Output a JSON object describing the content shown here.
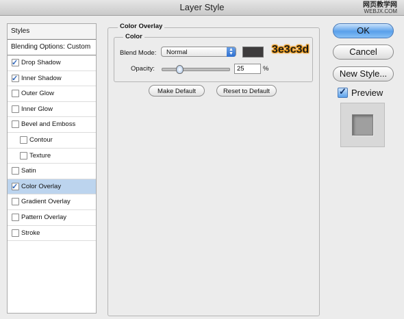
{
  "window": {
    "title": "Layer Style",
    "watermark_line1": "网页教学网",
    "watermark_line2": "WEBJX.COM"
  },
  "styles_panel": {
    "header": "Styles",
    "blending_options": "Blending Options: Custom",
    "items": [
      {
        "label": "Drop Shadow",
        "checked": true
      },
      {
        "label": "Inner Shadow",
        "checked": true
      },
      {
        "label": "Outer Glow",
        "checked": false
      },
      {
        "label": "Inner Glow",
        "checked": false
      },
      {
        "label": "Bevel and Emboss",
        "checked": false
      },
      {
        "label": "Contour",
        "checked": false
      },
      {
        "label": "Texture",
        "checked": false
      },
      {
        "label": "Satin",
        "checked": false
      },
      {
        "label": "Color Overlay",
        "checked": true
      },
      {
        "label": "Gradient Overlay",
        "checked": false
      },
      {
        "label": "Pattern Overlay",
        "checked": false
      },
      {
        "label": "Stroke",
        "checked": false
      }
    ]
  },
  "color_overlay": {
    "group_title": "Color Overlay",
    "subgroup_title": "Color",
    "blend_mode_label": "Blend Mode:",
    "blend_mode_value": "Normal",
    "swatch_color": "#3e3c3d",
    "hex_annotation": "3e3c3d",
    "opacity_label": "Opacity:",
    "opacity_value": "25",
    "opacity_unit": "%",
    "opacity_fraction": 0.25,
    "make_default_label": "Make Default",
    "reset_default_label": "Reset to Default"
  },
  "actions": {
    "ok_label": "OK",
    "cancel_label": "Cancel",
    "new_style_label": "New Style...",
    "preview_label": "Preview",
    "preview_checked": true
  }
}
